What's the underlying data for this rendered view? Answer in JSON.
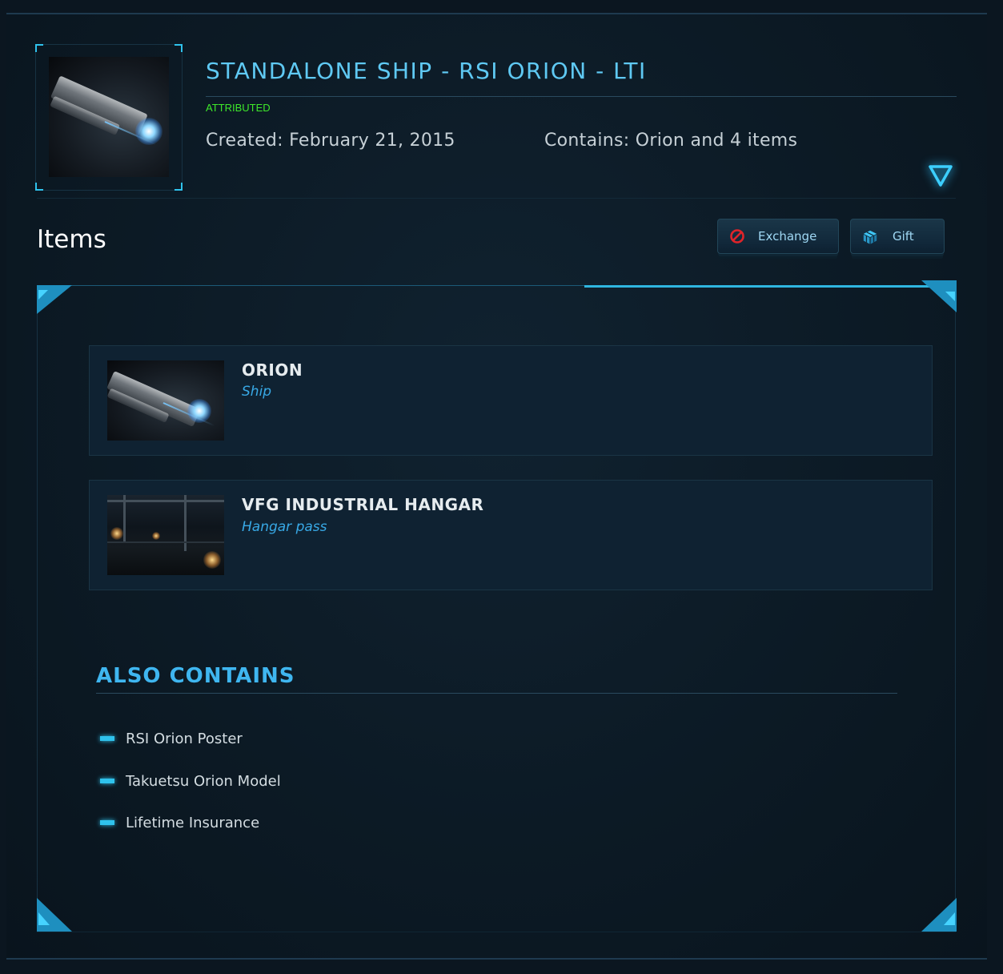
{
  "pledge": {
    "title": "STANDALONE SHIP - RSI ORION - LTI",
    "status": "ATTRIBUTED",
    "created": "Created: February 21, 2015",
    "contains": "Contains: Orion and 4 items"
  },
  "items_section": {
    "heading": "Items",
    "buttons": {
      "exchange": "Exchange",
      "gift": "Gift"
    },
    "items": [
      {
        "name": "ORION",
        "type": "Ship"
      },
      {
        "name": "VFG INDUSTRIAL HANGAR",
        "type": "Hangar pass"
      }
    ]
  },
  "also_contains": {
    "heading": "ALSO CONTAINS",
    "entries": [
      "RSI Orion Poster",
      "Takuetsu Orion Model",
      "Lifetime Insurance"
    ]
  },
  "colors": {
    "accent": "#2fc2ec",
    "title": "#5fc9f3",
    "status_green": "#3ee82a",
    "item_type": "#38a9e6"
  },
  "icons": {
    "toggle": "triangle-down-icon",
    "exchange": "no-entry-icon",
    "gift": "gift-box-icon",
    "bullet": "dash-bullet-icon"
  }
}
